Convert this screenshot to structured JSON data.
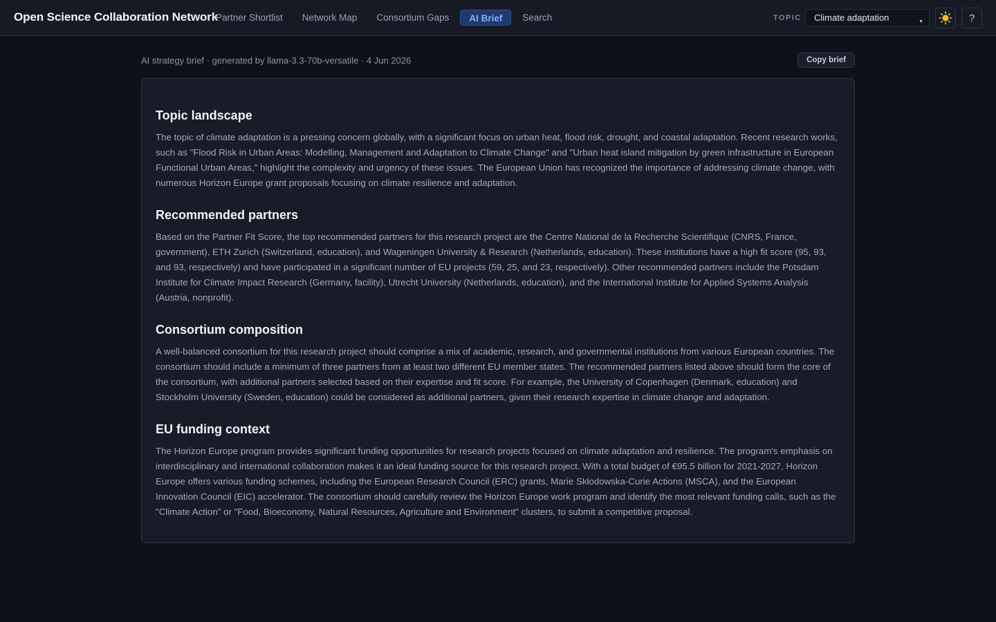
{
  "app": {
    "title": "Open Science Collaboration Network"
  },
  "nav": {
    "items": [
      {
        "label": "Partner Shortlist",
        "active": false
      },
      {
        "label": "Network Map",
        "active": false
      },
      {
        "label": "Consortium Gaps",
        "active": false
      },
      {
        "label": "AI Brief",
        "active": true
      },
      {
        "label": "Search",
        "active": false
      }
    ]
  },
  "topic": {
    "label": "TOPIC",
    "selected": "Climate adaptation"
  },
  "toolbar": {
    "theme_icon": "sun-icon",
    "help_label": "?"
  },
  "brief": {
    "meta": "AI strategy brief · generated by llama-3.3-70b-versatile · 4 Jun 2026",
    "copy_label": "Copy brief",
    "sections": [
      {
        "heading": "Topic landscape",
        "body": "The topic of climate adaptation is a pressing concern globally, with a significant focus on urban heat, flood risk, drought, and coastal adaptation. Recent research works, such as \"Flood Risk in Urban Areas: Modelling, Management and Adaptation to Climate Change\" and \"Urban heat island mitigation by green infrastructure in European Functional Urban Areas,\" highlight the complexity and urgency of these issues. The European Union has recognized the importance of addressing climate change, with numerous Horizon Europe grant proposals focusing on climate resilience and adaptation."
      },
      {
        "heading": "Recommended partners",
        "body": "Based on the Partner Fit Score, the top recommended partners for this research project are the Centre National de la Recherche Scientifique (CNRS, France, government), ETH Zurich (Switzerland, education), and Wageningen University & Research (Netherlands, education). These institutions have a high fit score (95, 93, and 93, respectively) and have participated in a significant number of EU projects (59, 25, and 23, respectively). Other recommended partners include the Potsdam Institute for Climate Impact Research (Germany, facility), Utrecht University (Netherlands, education), and the International Institute for Applied Systems Analysis (Austria, nonprofit)."
      },
      {
        "heading": "Consortium composition",
        "body": "A well-balanced consortium for this research project should comprise a mix of academic, research, and governmental institutions from various European countries. The consortium should include a minimum of three partners from at least two different EU member states. The recommended partners listed above should form the core of the consortium, with additional partners selected based on their expertise and fit score. For example, the University of Copenhagen (Denmark, education) and Stockholm University (Sweden, education) could be considered as additional partners, given their research expertise in climate change and adaptation."
      },
      {
        "heading": "EU funding context",
        "body": "The Horizon Europe program provides significant funding opportunities for research projects focused on climate adaptation and resilience. The program's emphasis on interdisciplinary and international collaboration makes it an ideal funding source for this research project. With a total budget of €95.5 billion for 2021-2027, Horizon Europe offers various funding schemes, including the European Research Council (ERC) grants, Marie Skłodowska-Curie Actions (MSCA), and the European Innovation Council (EIC) accelerator. The consortium should carefully review the Horizon Europe work program and identify the most relevant funding calls, such as the \"Climate Action\" or \"Food, Bioeconomy, Natural Resources, Agriculture and Environment\" clusters, to submit a competitive proposal."
      }
    ]
  },
  "colors": {
    "background": "#0f111a",
    "topbar": "#161a25",
    "card": "#181c28",
    "accent": "#7fb0ff",
    "active_tab_bg": "#1f3a6b",
    "sun": "#f5b82e"
  }
}
